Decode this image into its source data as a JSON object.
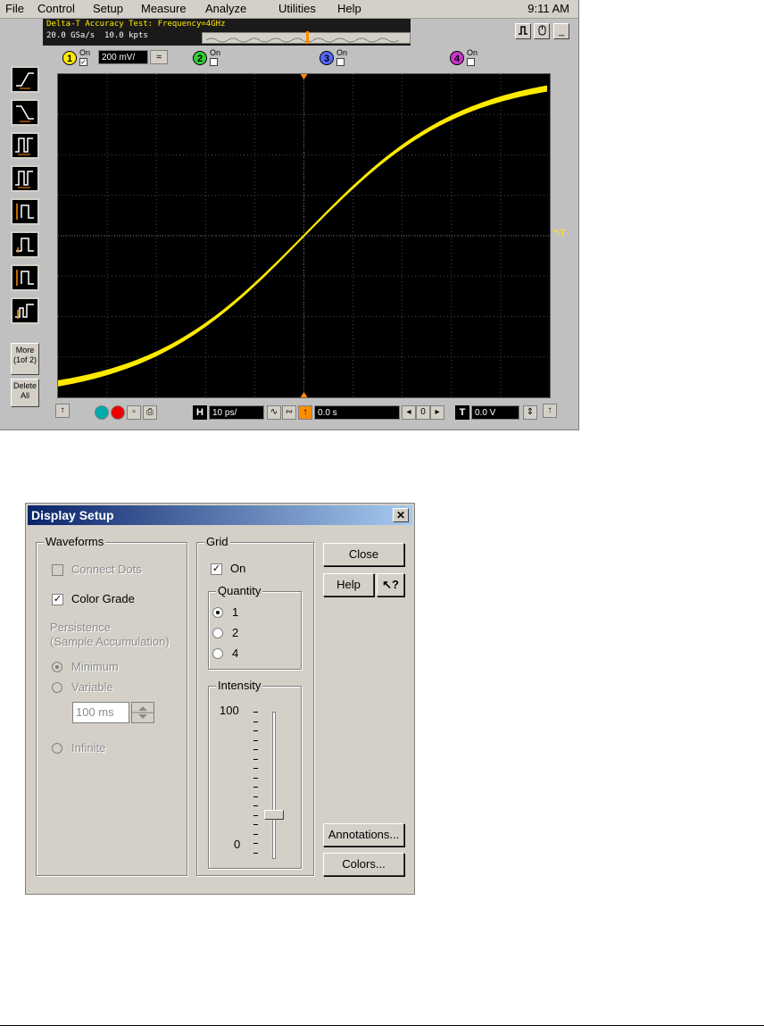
{
  "menu": {
    "items": [
      "File",
      "Control",
      "Setup",
      "Measure",
      "Analyze",
      "Utilities",
      "Help"
    ],
    "clock": "9:11 AM"
  },
  "status": {
    "title": "Delta-T Accuracy Test: Frequency=4GHz",
    "sample_rate": "20.0 GSa/s",
    "points": "10.0 kpts"
  },
  "channels": {
    "ch1": {
      "number": "1",
      "on_label": "On",
      "checked": "✓",
      "scale": "200 mV/",
      "color": "#ffea00"
    },
    "ch2": {
      "number": "2",
      "on_label": "On",
      "color": "#33cc33"
    },
    "ch3": {
      "number": "3",
      "on_label": "On",
      "color": "#5566ff"
    },
    "ch4": {
      "number": "4",
      "on_label": "On",
      "color": "#cc33cc"
    }
  },
  "left_toolbar": {
    "more_label": "More",
    "more_page": "(1of 2)",
    "delete_label": "Delete",
    "delete_all": "All"
  },
  "waveform": {
    "color": "#ffea00",
    "background": "#000000"
  },
  "bottombar": {
    "horiz_label": "H",
    "horiz_scale": "10 ps/",
    "delay_value": "0.0 s",
    "trigger_label": "T",
    "trigger_level": "0.0 V"
  },
  "dialog": {
    "title": "Display Setup",
    "close_x": "✕",
    "waveforms": {
      "label": "Waveforms",
      "connect_dots": "Connect Dots",
      "color_grade": "Color Grade",
      "color_grade_check": "✓",
      "persistence_1": "Persistence",
      "persistence_2": "(Sample Accumulation)",
      "minimum": "Minimum",
      "variable": "Variable",
      "variable_value": "100 ms",
      "infinite": "Infinite"
    },
    "grid": {
      "label": "Grid",
      "on": "On",
      "on_check": "✓",
      "quantity_label": "Quantity",
      "quantities": [
        "1",
        "2",
        "4"
      ],
      "intensity_label": "Intensity",
      "intensity_max": "100",
      "intensity_min": "0",
      "intensity_value": 0.3
    },
    "buttons": {
      "close": "Close",
      "help": "Help",
      "help_pointer": "↖?",
      "annotations": "Annotations...",
      "colors": "Colors..."
    }
  }
}
